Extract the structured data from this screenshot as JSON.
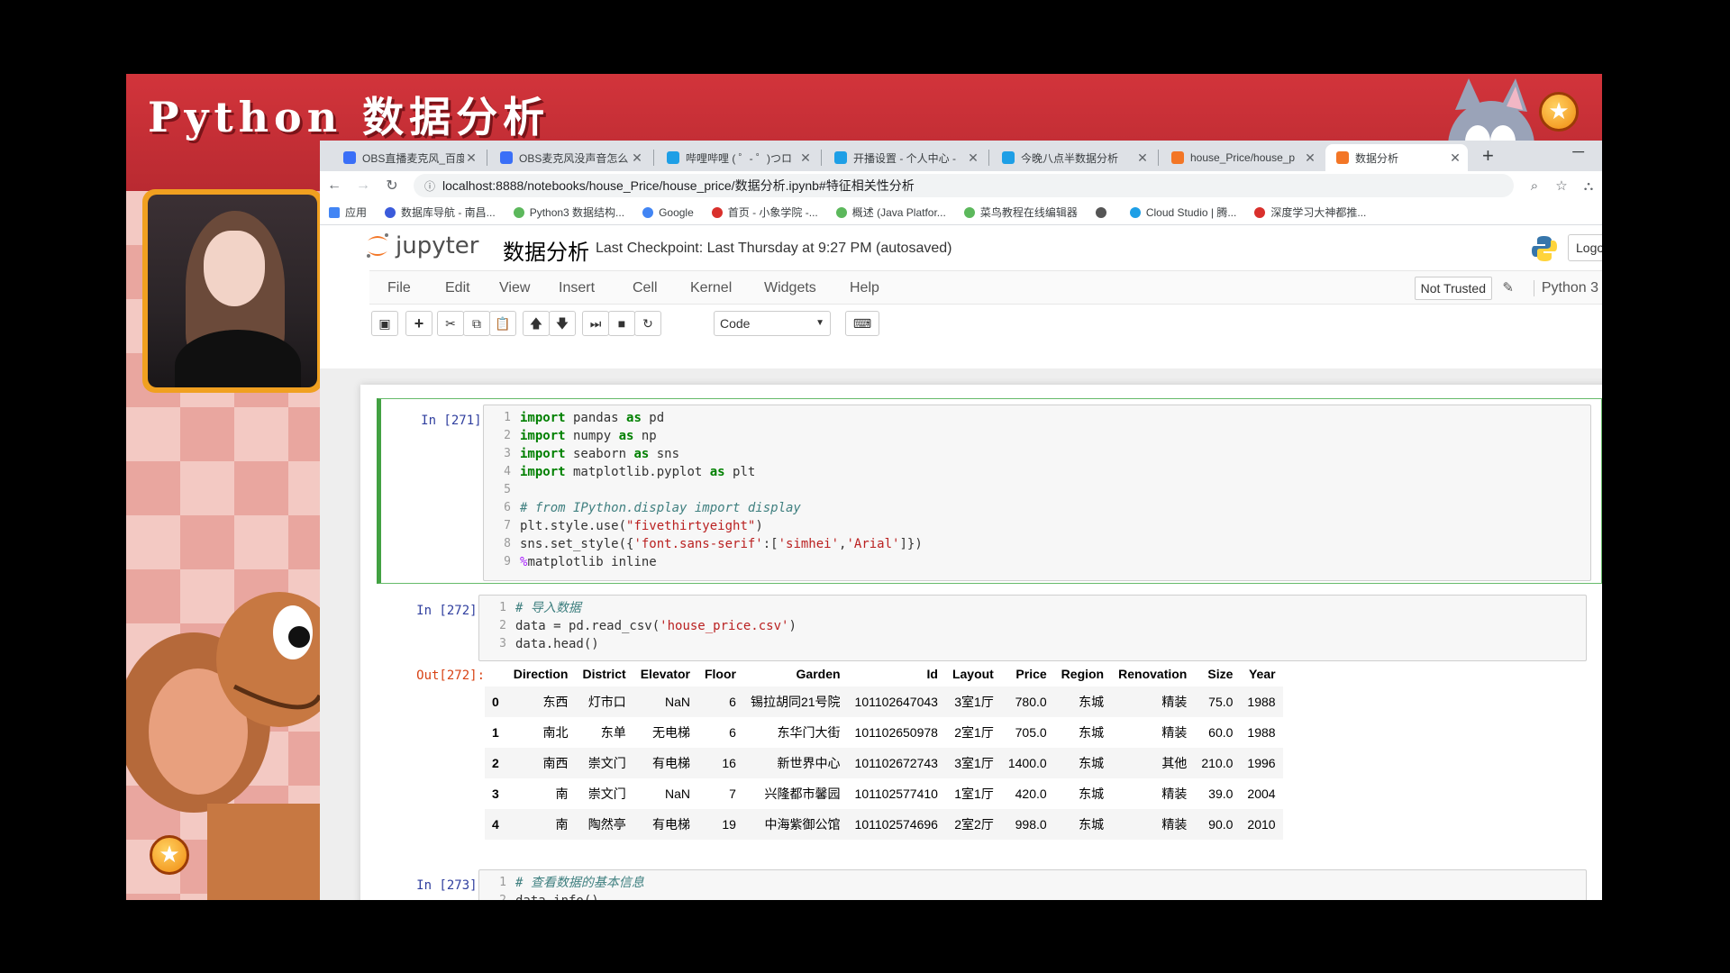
{
  "stream_overlay": {
    "title": "Python 数据分析"
  },
  "browser": {
    "tabs": [
      {
        "label": "OBS直播麦克风_百度",
        "fav_color": "#3a6ff7"
      },
      {
        "label": "OBS麦克风没声音怎么",
        "fav_color": "#3a6ff7"
      },
      {
        "label": "哔哩哔哩 ( ゜- ゜)つロ",
        "fav_color": "#1e9fe6"
      },
      {
        "label": "开播设置 - 个人中心 -",
        "fav_color": "#1e9fe6"
      },
      {
        "label": "今晚八点半数据分析",
        "fav_color": "#1e9fe6"
      },
      {
        "label": "house_Price/house_p",
        "fav_color": "#f37626"
      },
      {
        "label": "数据分析",
        "fav_color": "#f37626"
      }
    ],
    "url": "localhost:8888/notebooks/house_Price/house_price/数据分析.ipynb#特征相关性分析",
    "bookmarks": [
      {
        "label": "应用",
        "color": "#4285f4"
      },
      {
        "label": "数据库导航 - 南昌...",
        "color": "#3b5bdb"
      },
      {
        "label": "Python3 数据结构...",
        "color": "#5cb85c"
      },
      {
        "label": "Google",
        "color": "#4285f4"
      },
      {
        "label": "首页 - 小象学院 -...",
        "color": "#d9302c"
      },
      {
        "label": "概述 (Java Platfor...",
        "color": "#5cb85c"
      },
      {
        "label": "菜鸟教程在线编辑器",
        "color": "#5cb85c"
      },
      {
        "label": "",
        "color": "#555555"
      },
      {
        "label": "Cloud Studio | 腾...",
        "color": "#1e9fe6"
      },
      {
        "label": "深度学习大神都推...",
        "color": "#d9302c"
      }
    ]
  },
  "jupyter": {
    "logo_text": "jupyter",
    "notebook_name": "数据分析",
    "checkpoint": "Last Checkpoint: Last Thursday at 9:27 PM (autosaved)",
    "logout": "Logo",
    "menus": [
      "File",
      "Edit",
      "View",
      "Insert",
      "Cell",
      "Kernel",
      "Widgets",
      "Help"
    ],
    "trust": "Not Trusted",
    "kernel": "Python 3",
    "cell_type": "Code"
  },
  "cells": {
    "c271": {
      "prompt": "In  [271]:"
    },
    "c272": {
      "prompt": "In  [272]:",
      "out_prompt": "Out[272]:"
    },
    "c273": {
      "prompt": "In  [273]:"
    }
  },
  "dataframe": {
    "columns": [
      "",
      "Direction",
      "District",
      "Elevator",
      "Floor",
      "Garden",
      "Id",
      "Layout",
      "Price",
      "Region",
      "Renovation",
      "Size",
      "Year"
    ],
    "rows": [
      [
        "0",
        "东西",
        "灯市口",
        "NaN",
        "6",
        "锡拉胡同21号院",
        "101102647043",
        "3室1厅",
        "780.0",
        "东城",
        "精装",
        "75.0",
        "1988"
      ],
      [
        "1",
        "南北",
        "东单",
        "无电梯",
        "6",
        "东华门大街",
        "101102650978",
        "2室1厅",
        "705.0",
        "东城",
        "精装",
        "60.0",
        "1988"
      ],
      [
        "2",
        "南西",
        "崇文门",
        "有电梯",
        "16",
        "新世界中心",
        "101102672743",
        "3室1厅",
        "1400.0",
        "东城",
        "其他",
        "210.0",
        "1996"
      ],
      [
        "3",
        "南",
        "崇文门",
        "NaN",
        "7",
        "兴隆都市馨园",
        "101102577410",
        "1室1厅",
        "420.0",
        "东城",
        "精装",
        "39.0",
        "2004"
      ],
      [
        "4",
        "南",
        "陶然亭",
        "有电梯",
        "19",
        "中海紫御公馆",
        "101102574696",
        "2室2厅",
        "998.0",
        "东城",
        "精装",
        "90.0",
        "2010"
      ]
    ]
  }
}
